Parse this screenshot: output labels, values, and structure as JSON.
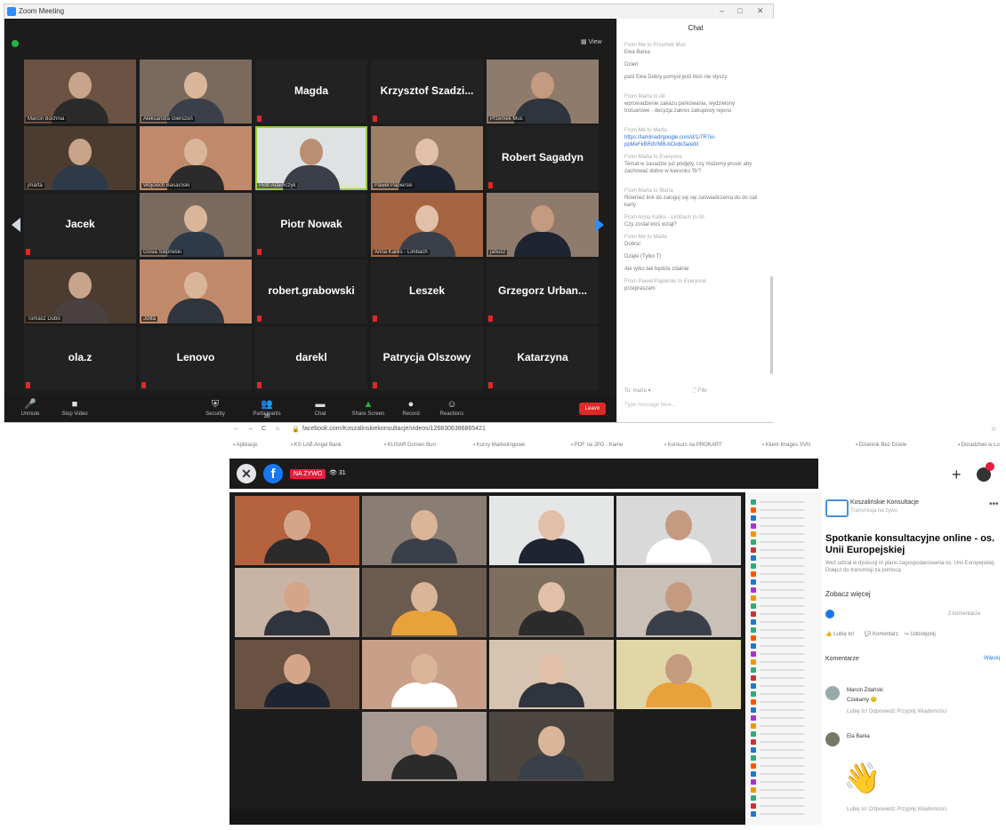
{
  "zoom": {
    "window_title": "Zoom Meeting",
    "view_label": "View",
    "tiles": [
      {
        "name": "",
        "label": "Marcin Bochnia"
      },
      {
        "name": "",
        "label": "Aleksandra Gierszon"
      },
      {
        "name": "Magda",
        "label": ""
      },
      {
        "name": "Krzysztof Szadzi...",
        "label": ""
      },
      {
        "name": "",
        "label": "Przemek Mus"
      },
      {
        "name": "",
        "label": "jmarta"
      },
      {
        "name": "",
        "label": "Wojciech Basaroski"
      },
      {
        "name": "",
        "label": "Piotr Adamczyk"
      },
      {
        "name": "",
        "label": "Paweł Papierski"
      },
      {
        "name": "Robert Sagadyn",
        "label": ""
      },
      {
        "name": "Jacek",
        "label": ""
      },
      {
        "name": "",
        "label": "Gosia Sieprwski"
      },
      {
        "name": "Piotr Nowak",
        "label": ""
      },
      {
        "name": "",
        "label": "Anna Kaliks - Limbach"
      },
      {
        "name": "",
        "label": "janusz"
      },
      {
        "name": "",
        "label": "Tomasz Dubo"
      },
      {
        "name": "",
        "label": "Jolita"
      },
      {
        "name": "robert.grabowski",
        "label": ""
      },
      {
        "name": "Leszek",
        "label": ""
      },
      {
        "name": "Grzegorz Urban...",
        "label": ""
      },
      {
        "name": "ola.z",
        "label": ""
      },
      {
        "name": "Lenovo",
        "label": ""
      },
      {
        "name": "darekl",
        "label": ""
      },
      {
        "name": "Patrycja Olszowy",
        "label": ""
      },
      {
        "name": "Katarzyna",
        "label": ""
      }
    ],
    "toolbar": {
      "unmute": "Unmute",
      "stop_video": "Stop Video",
      "security": "Security",
      "participants": "Participants",
      "participants_count": "35",
      "chat": "Chat",
      "share_screen": "Share Screen",
      "record": "Record",
      "reactions": "Reactions",
      "leave": "Leave"
    },
    "chat": {
      "title": "Chat",
      "messages": [
        {
          "from": "From Me to Przemek Mus",
          "text": "Ewa Bania"
        },
        {
          "from": "",
          "text": "Dzień"
        },
        {
          "from": "",
          "text": "pani Ewa Dobry pomysł jeśli ktoś nie słyszy"
        },
        {
          "from": "From Marta to All",
          "text": "wprowadzenie zakazu parkowania, wydzielony trotuarowe - decyzja zakres zakupowy rejonu"
        },
        {
          "from": "From Me to Marta",
          "text": "https://lamlinadrgoogle.com/d/1/7R7ei-ppMeFkBRdVMB-bCkdk3a/edit"
        },
        {
          "from": "From Marta to Everyone",
          "text": "Temat w zasadzie już podjęty, czy możemy prosić aby zachować dobre w kierunku 'fb'?"
        },
        {
          "from": "From Marta to Marta",
          "text": "Również link do zaloguj się się zaświadczenia do do sali karty"
        },
        {
          "from": "From Anna Kaliks - Limbach to All",
          "text": "Czy został ktoś wziął?"
        },
        {
          "from": "From Me to Marta",
          "text": "Dobra!"
        },
        {
          "from": "",
          "text": "Dzięki (Tylko T)"
        },
        {
          "from": "",
          "text": "Ale tylko tak będzie zdalnie"
        },
        {
          "from": "From Paweł Papierski to Everyone",
          "text": "przepraszam"
        }
      ],
      "to_label": "To: marta",
      "file_label": "File",
      "type_placeholder": "Type message here..."
    }
  },
  "browser": {
    "url": "facebook.com/Koszalinskiekonsultacje/videos/1268306386865421",
    "bookmarks": [
      "Aplikacje",
      "KS LAB Angel Bank",
      "KUSAR Domen Buri",
      "Kursy Marketingowe",
      "PDF na JPG - Kame",
      "Konkurs na PROKART",
      "Klient Images SVN",
      "Dziennik Bez Dziele",
      "Doradztwo w Lo"
    ],
    "live_label": "NA ŻYWO",
    "viewers": "31",
    "post": {
      "page_name": "Koszalińskie Konsultacje",
      "page_sub": "Transmisja na żywo",
      "title": "Spotkanie konsultacyjne online - os. Unii Europejskiej",
      "description": "Weź udział w dyskusji nt planu zagospodarowania os. Unii Europejskiej. Dołącz do transmisji za pomocą",
      "see_more": "Zobacz więcej",
      "comments_count": "2 komentarze",
      "like": "Lubię to!",
      "comment": "Komentarz",
      "share": "Udostępnij",
      "comments_section": "Komentarze",
      "more_link": "Więcej",
      "comments": [
        {
          "author": "Marcin Zdański",
          "text": "Czekamy 😊",
          "actions": "Lubię to!  Odpowiedz  Przypnij  Wiadomości"
        },
        {
          "author": "Ela Bania",
          "text": "",
          "actions": "Lubię to!  Odpowiedz  Przypnij  Wiadomości"
        }
      ]
    }
  },
  "colors": {
    "zoom_blue": "#2d8cff",
    "fb_blue": "#1877f2",
    "live_red": "#e41e3f",
    "active_green": "#9ccc3c"
  }
}
